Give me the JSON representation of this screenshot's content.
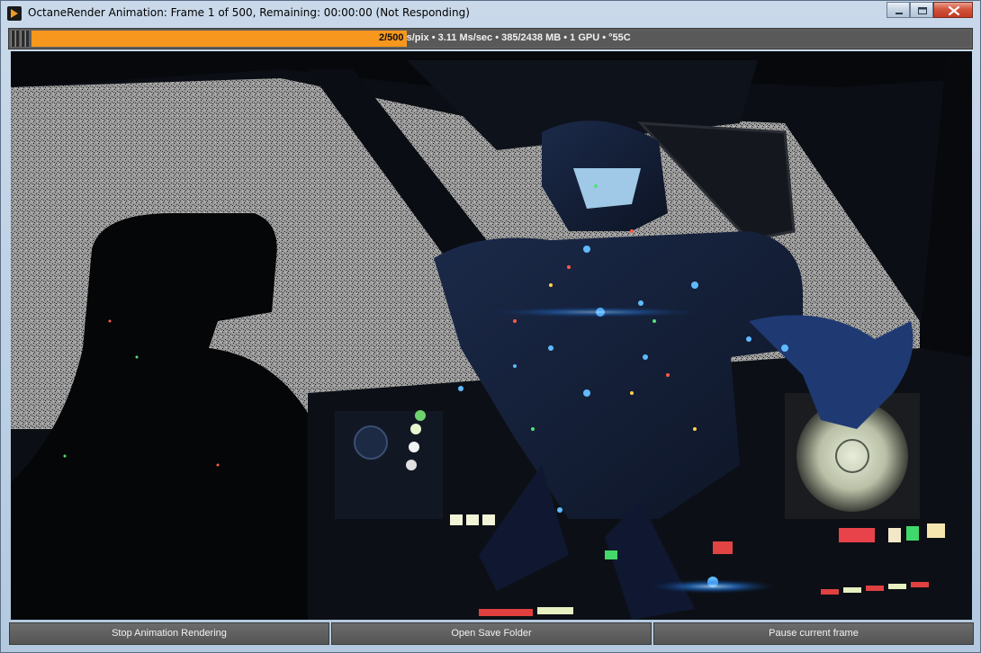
{
  "window": {
    "title": "OctaneRender Animation: Frame 1 of 500, Remaining: 00:00:00 (Not Responding)",
    "icon": "octane-icon",
    "controls": [
      "minimize-icon",
      "maximize-icon",
      "close-icon"
    ]
  },
  "render_status": {
    "progress_fraction": 0.004,
    "samples": "2/500",
    "rest": "s/pix • 3.11 Ms/sec • 385/2438 MB • 1 GPU • °55C",
    "fill_color": "#f7971d"
  },
  "viewport": {
    "description_icon": "render-viewport"
  },
  "buttons": {
    "stop": "Stop Animation Rendering",
    "open_folder": "Open Save Folder",
    "pause": "Pause current frame"
  }
}
